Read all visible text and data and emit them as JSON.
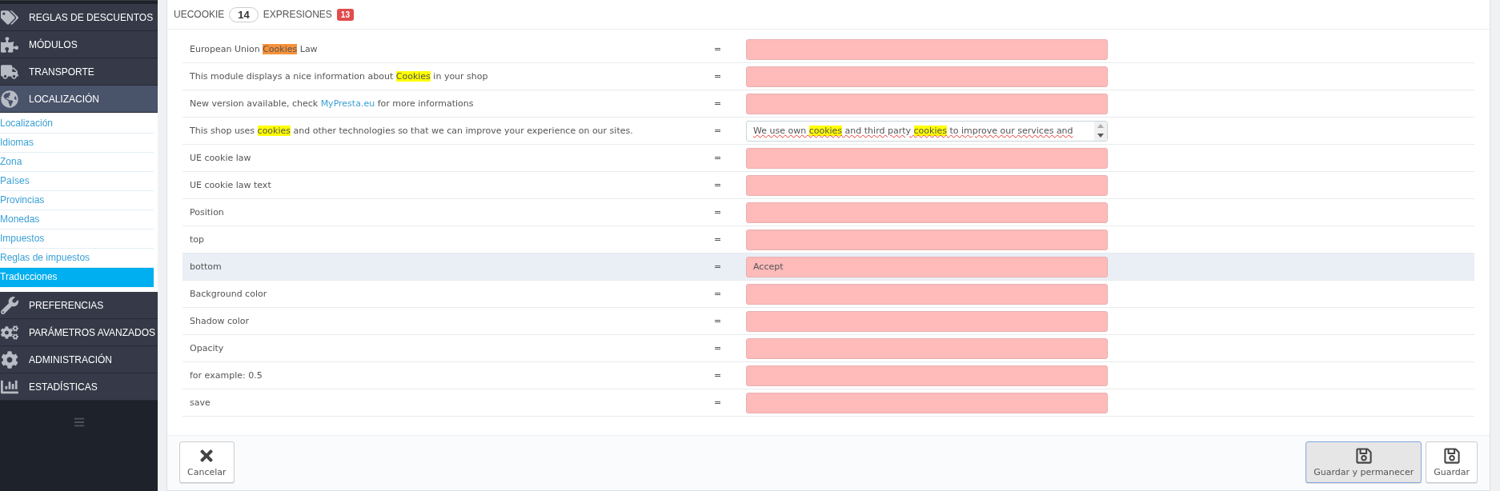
{
  "sidebar": {
    "menu": [
      {
        "label": "REGLAS DE DESCUENTOS",
        "active": false
      },
      {
        "label": "MÓDULOS",
        "active": false
      },
      {
        "label": "TRANSPORTE",
        "active": false
      },
      {
        "label": "LOCALIZACIÓN",
        "active": true,
        "children": [
          {
            "label": "Localización",
            "selected": false
          },
          {
            "label": "Idiomas",
            "selected": false
          },
          {
            "label": "Zona",
            "selected": false
          },
          {
            "label": "Países",
            "selected": false
          },
          {
            "label": "Provincias",
            "selected": false
          },
          {
            "label": "Monedas",
            "selected": false
          },
          {
            "label": "Impuestos",
            "selected": false
          },
          {
            "label": "Reglas de impuestos",
            "selected": false
          },
          {
            "label": "Traducciones",
            "selected": true
          }
        ]
      },
      {
        "label": "PREFERENCIAS",
        "active": false
      },
      {
        "label": "PARÁMETROS AVANZADOS",
        "active": false
      },
      {
        "label": "ADMINISTRACIÓN",
        "active": false
      },
      {
        "label": "ESTADÍSTICAS",
        "active": false
      }
    ]
  },
  "panel": {
    "title": "UECOOKIE",
    "count": "14",
    "expressions_label": "EXPRESIONES",
    "missing_count": "13",
    "rows": [
      {
        "label": [
          {
            "kind": "text",
            "text": "European Union "
          },
          {
            "kind": "highlight",
            "text": "Cookies",
            "color": "#f7923a"
          },
          {
            "kind": "text",
            "text": " Law"
          }
        ],
        "equals": "=",
        "field": {
          "kind": "input",
          "missing": true
        },
        "hovered": false
      },
      {
        "label": [
          {
            "kind": "text",
            "text": "This module displays a nice information about "
          },
          {
            "kind": "highlight",
            "text": "Cookies",
            "color": "#ffff00"
          },
          {
            "kind": "text",
            "text": " in your shop"
          }
        ],
        "equals": "=",
        "field": {
          "kind": "input",
          "missing": true
        },
        "hovered": false
      },
      {
        "label": [
          {
            "kind": "text",
            "text": "New version available, check "
          },
          {
            "kind": "link",
            "text": "MyPresta.eu"
          },
          {
            "kind": "text",
            "text": " for more informations"
          }
        ],
        "equals": "=",
        "field": {
          "kind": "input",
          "missing": true
        },
        "hovered": false
      },
      {
        "label": [
          {
            "kind": "text",
            "text": "This shop uses "
          },
          {
            "kind": "highlight",
            "text": "cookies",
            "color": "#ffff00"
          },
          {
            "kind": "text",
            "text": " and other technologies so that we can improve your experience on our sites."
          }
        ],
        "equals": "=",
        "field": {
          "kind": "textarea",
          "missing": false,
          "value": [
            {
              "kind": "text",
              "text": "We use own "
            },
            {
              "kind": "highlight",
              "text": "cookies",
              "color": "#ffff00"
            },
            {
              "kind": "text",
              "text": "  and third party "
            },
            {
              "kind": "highlight",
              "text": "cookies",
              "color": "#ffff00"
            },
            {
              "kind": "text",
              "text": " to improve our services and"
            }
          ]
        },
        "hovered": false
      },
      {
        "label": [
          {
            "kind": "text",
            "text": "UE cookie law"
          }
        ],
        "equals": "=",
        "field": {
          "kind": "input",
          "missing": true
        },
        "hovered": false
      },
      {
        "label": [
          {
            "kind": "text",
            "text": "UE cookie law text"
          }
        ],
        "equals": "=",
        "field": {
          "kind": "input",
          "missing": true
        },
        "hovered": false
      },
      {
        "label": [
          {
            "kind": "text",
            "text": "Position"
          }
        ],
        "equals": "=",
        "field": {
          "kind": "input",
          "missing": true
        },
        "hovered": false
      },
      {
        "label": [
          {
            "kind": "text",
            "text": "top"
          }
        ],
        "equals": "=",
        "field": {
          "kind": "input",
          "missing": true
        },
        "hovered": false
      },
      {
        "label": [
          {
            "kind": "text",
            "text": "bottom"
          }
        ],
        "equals": "=",
        "field": {
          "kind": "input",
          "missing": true,
          "value": [
            {
              "kind": "text",
              "text": "Accept"
            }
          ]
        },
        "hovered": true
      },
      {
        "label": [
          {
            "kind": "text",
            "text": "Background color"
          }
        ],
        "equals": "=",
        "field": {
          "kind": "input",
          "missing": true
        },
        "hovered": false
      },
      {
        "label": [
          {
            "kind": "text",
            "text": "Shadow color"
          }
        ],
        "equals": "=",
        "field": {
          "kind": "input",
          "missing": true
        },
        "hovered": false
      },
      {
        "label": [
          {
            "kind": "text",
            "text": "Opacity"
          }
        ],
        "equals": "=",
        "field": {
          "kind": "input",
          "missing": true
        },
        "hovered": false
      },
      {
        "label": [
          {
            "kind": "text",
            "text": "for example: 0.5"
          }
        ],
        "equals": "=",
        "field": {
          "kind": "input",
          "missing": true
        },
        "hovered": false
      },
      {
        "label": [
          {
            "kind": "text",
            "text": "save"
          }
        ],
        "equals": "=",
        "field": {
          "kind": "input",
          "missing": true
        },
        "hovered": false
      }
    ]
  },
  "footer": {
    "buttons": [
      {
        "kind": "cancel",
        "label": "Cancelar",
        "focused": false
      },
      {
        "kind": "save",
        "label": "Guardar y permanecer",
        "focused": true
      },
      {
        "kind": "save",
        "label": "Guardar",
        "focused": false
      }
    ]
  }
}
